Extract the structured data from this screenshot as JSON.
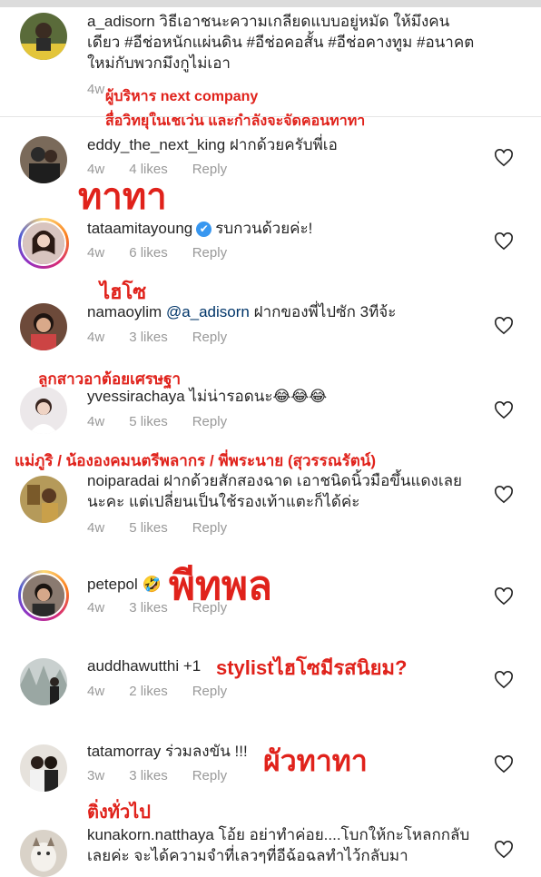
{
  "post": {
    "username": "a_adisorn",
    "caption": "วิธีเอาชนะความเกลียดแบบอยู่หมัด ให้มึงคนเดียว #อีช่อหนักแผ่นดิน #อีช่อคอสั้น #อีช่อคางทูม #อนาคตใหม่กับพวกมึงกูไม่เอา",
    "age": "4w"
  },
  "comments": [
    {
      "username": "eddy_the_next_king",
      "text": "ฝากด้วยครับพี่เอ",
      "age": "4w",
      "likes": "4 likes",
      "reply": "Reply"
    },
    {
      "username": "tataamitayoung",
      "text": "รบกวนด้วยค่ะ!",
      "age": "4w",
      "likes": "6 likes",
      "reply": "Reply",
      "verified": "✔"
    },
    {
      "username": "namaoylim",
      "mention": "@a_adisorn",
      "text": "ฝากของพี่ไปซัก 3ทีจ้ะ",
      "age": "4w",
      "likes": "3 likes",
      "reply": "Reply"
    },
    {
      "username": "yvessirachaya",
      "text": "ไม่น่ารอดนะ😂😂😂",
      "age": "4w",
      "likes": "5 likes",
      "reply": "Reply"
    },
    {
      "username": "noiparadai",
      "text": "ฝากด้วยสักสองฉาด เอาชนิดนิ้วมือขึ้นแดงเลยนะคะ แต่เปลี่ยนเป็นใช้รองเท้าแตะก็ได้ค่ะ",
      "age": "4w",
      "likes": "5 likes",
      "reply": "Reply"
    },
    {
      "username": "petepol",
      "text": "🤣",
      "age": "4w",
      "likes": "3 likes",
      "reply": "Reply"
    },
    {
      "username": "auddhawutthi",
      "text": "+1",
      "age": "4w",
      "likes": "2 likes",
      "reply": "Reply"
    },
    {
      "username": "tatamorray",
      "text": "ร่วมลงขัน !!!",
      "age": "3w",
      "likes": "3 likes",
      "reply": "Reply"
    },
    {
      "username": "kunakorn.natthaya",
      "text": "โอ้ย อย่าทำค่อย....โบกให้กะโหลกกลับเลยค่ะ จะได้ความจำที่เลวๆที่อีฉ้อฉลทำไว้กลับมา"
    }
  ],
  "annotations": {
    "note_1": "ผู้บริหาร next company",
    "note_2": "สื่อวิทยุในเชเว่น และกำลังจะจัดคอนทาทา",
    "note_3": "ทาทา",
    "note_4": "ไฮโซ",
    "note_5": "ลูกสาวอาต้อยเศรษฐา",
    "note_6": "แม่ภูริ / น้ององคมนตรีพลากร / พี่พระนาย (สุวรรณรัตน์)",
    "note_7": "พีทพล",
    "note_8": "stylistไฮโซมีรสนิยม?",
    "note_9": "ผัวทาทา",
    "note_10": "ติ่งทั่วไป"
  },
  "colors": {
    "annotation": "#e0221b",
    "meta": "#999999",
    "username": "#262626",
    "verified": "#3897f0"
  }
}
